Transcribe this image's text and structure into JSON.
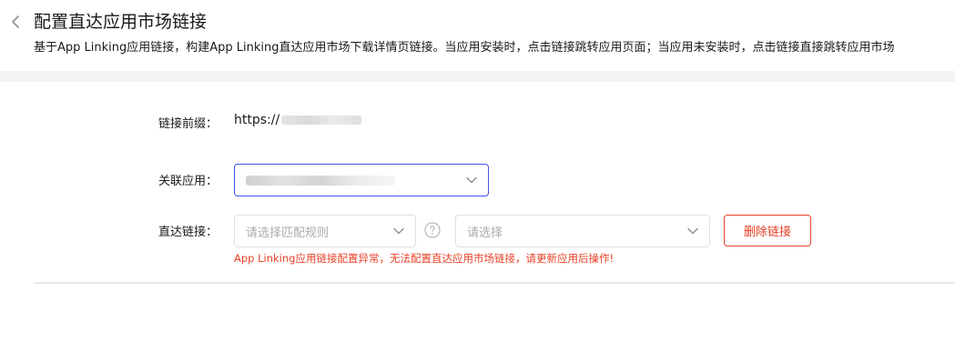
{
  "header": {
    "title": "配置直达应用市场链接",
    "description": "基于App Linking应用链接，构建App Linking直达应用市场下载详情页链接。当应用安装时，点击链接跳转应用页面；当应用未安装时，点击链接直接跳转应用市场"
  },
  "form": {
    "prefix": {
      "label": "链接前缀：",
      "value": "https://"
    },
    "app": {
      "label": "关联应用："
    },
    "direct_link": {
      "label": "直达链接：",
      "rule_placeholder": "请选择匹配规则",
      "target_placeholder": "请选择",
      "delete_label": "删除链接",
      "error": "App Linking应用链接配置异常，无法配置直达应用市场链接，请更新应用后操作!"
    }
  },
  "colors": {
    "accent": "#3f56ea",
    "danger": "#e84026",
    "text": "#191919",
    "placeholder": "#a8abb2"
  },
  "icons": {
    "back": "chevron-left-icon",
    "dropdown": "chevron-down-icon",
    "help": "question-circle-icon"
  }
}
